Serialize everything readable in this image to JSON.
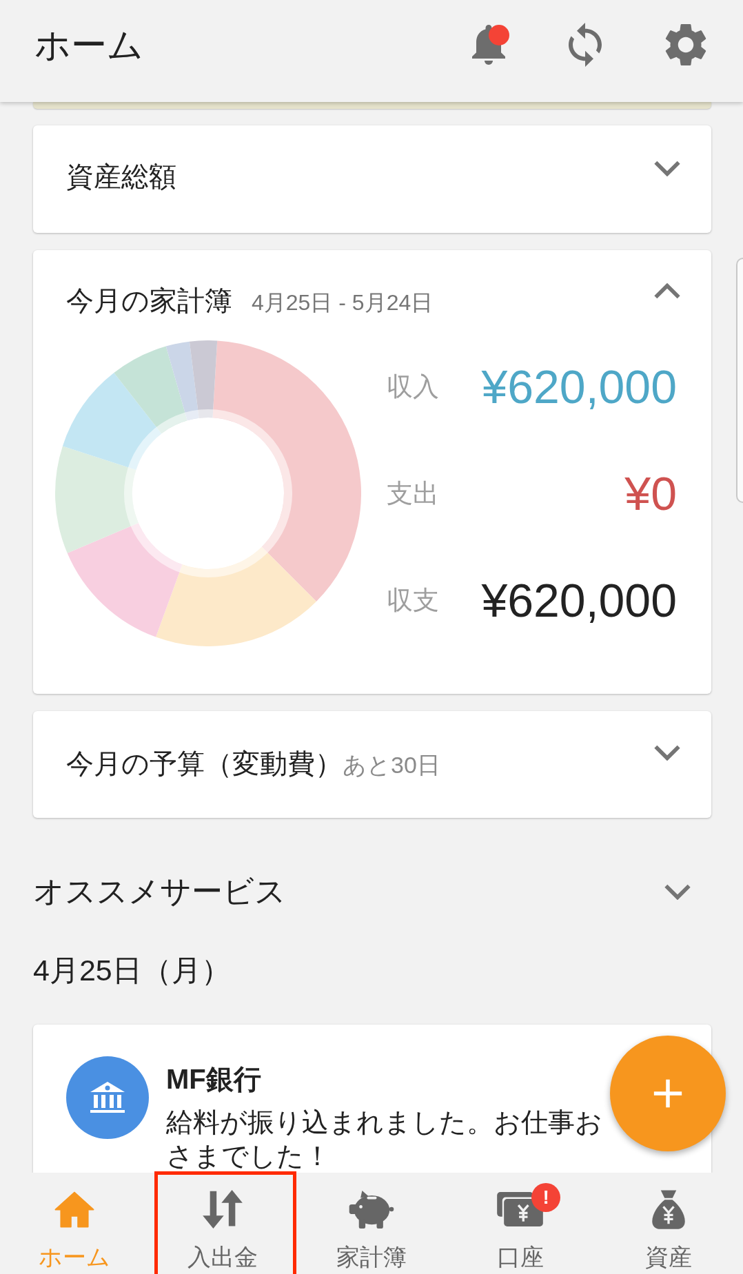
{
  "app_bar": {
    "title": "ホーム",
    "actions": [
      {
        "kind": "notifications",
        "badge": true
      },
      {
        "kind": "sync",
        "badge": false
      },
      {
        "kind": "settings",
        "badge": false
      }
    ]
  },
  "total_assets": {
    "title": "資産総額",
    "expanded": false
  },
  "household": {
    "title": "今月の家計簿",
    "period": "4月25日 - 5月24日",
    "expanded": true,
    "summary": [
      {
        "kind": "income",
        "label": "収入",
        "value": "¥620,000"
      },
      {
        "kind": "expense",
        "label": "支出",
        "value": "¥0"
      },
      {
        "kind": "balance",
        "label": "収支",
        "value": "¥620,000"
      }
    ]
  },
  "budget": {
    "title": "今月の予算（変動費）",
    "remaining": "あと30日",
    "expanded": false
  },
  "recommended": {
    "title": "オススメサービス",
    "expanded": false
  },
  "timeline": {
    "date": "4月25日（月）",
    "entries": [
      {
        "kind": "bank",
        "title": "MF銀行",
        "message_lines": [
          "給料が振り込まれました。お仕事お",
          "さまでした！"
        ]
      }
    ]
  },
  "bottom_nav": [
    {
      "kind": "home",
      "label": "ホーム",
      "selected": true,
      "highlighted": false
    },
    {
      "kind": "transfers",
      "label": "入出金",
      "selected": false,
      "highlighted": true
    },
    {
      "kind": "household",
      "label": "家計簿",
      "selected": false,
      "highlighted": false
    },
    {
      "kind": "accounts",
      "label": "口座",
      "selected": false,
      "highlighted": false,
      "badge": "!"
    },
    {
      "kind": "assets",
      "label": "資産",
      "selected": false,
      "highlighted": false
    }
  ]
}
